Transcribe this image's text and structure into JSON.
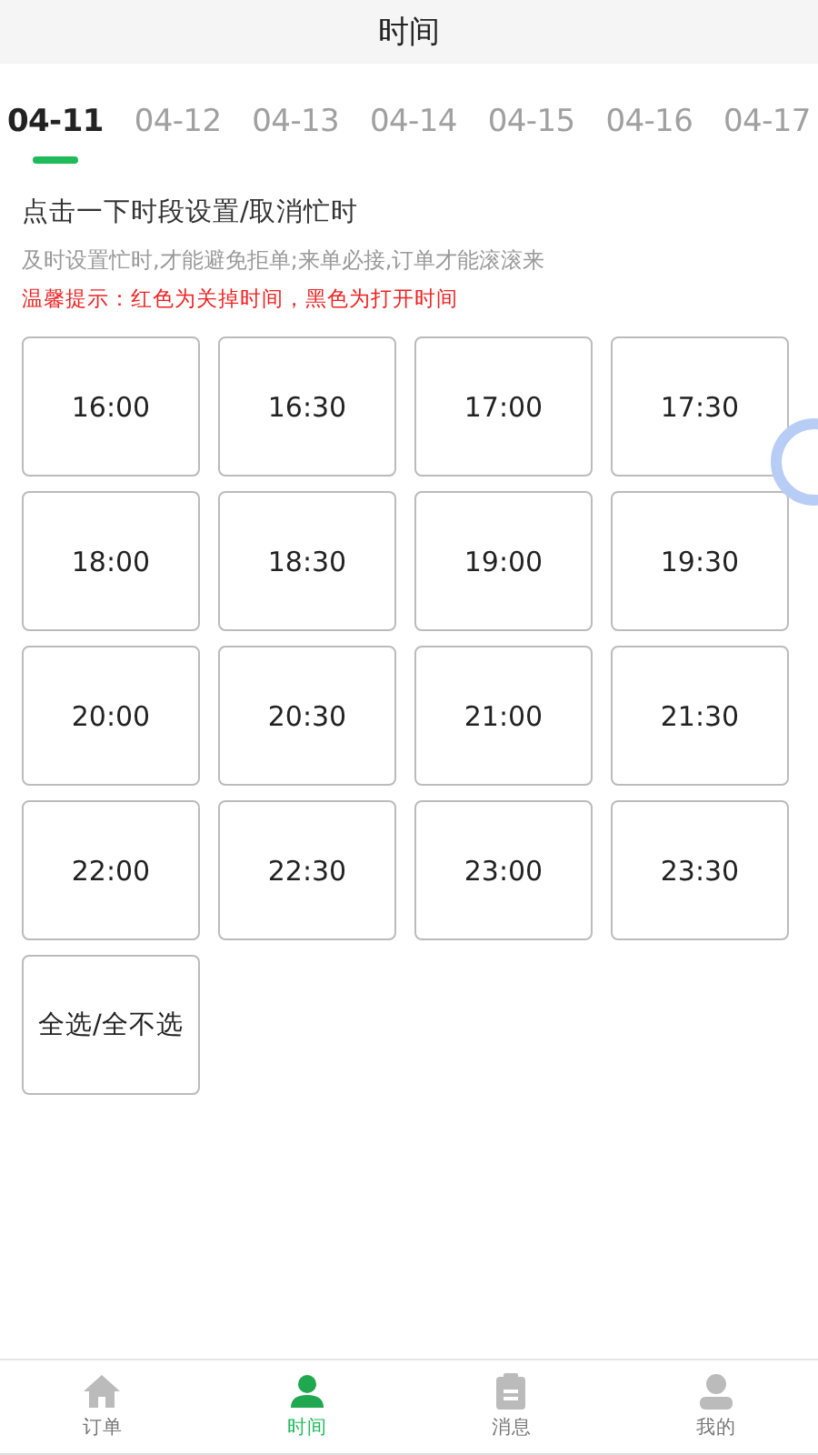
{
  "header": {
    "title": "时间"
  },
  "dates": [
    {
      "label": "04-11",
      "selected": true
    },
    {
      "label": "04-12",
      "selected": false
    },
    {
      "label": "04-13",
      "selected": false
    },
    {
      "label": "04-14",
      "selected": false
    },
    {
      "label": "04-15",
      "selected": false
    },
    {
      "label": "04-16",
      "selected": false
    },
    {
      "label": "04-17",
      "selected": false
    }
  ],
  "instruction": "点击一下时段设置/取消忙时",
  "hint": "及时设置忙时,才能避免拒单;来单必接,订单才能滚滚来",
  "tip": "温馨提示：红色为关掉时间，黑色为打开时间",
  "slots": [
    {
      "label": "16:00",
      "closed": false
    },
    {
      "label": "16:30",
      "closed": false
    },
    {
      "label": "17:00",
      "closed": false
    },
    {
      "label": "17:30",
      "closed": false
    },
    {
      "label": "18:00",
      "closed": false
    },
    {
      "label": "18:30",
      "closed": false
    },
    {
      "label": "19:00",
      "closed": false
    },
    {
      "label": "19:30",
      "closed": false
    },
    {
      "label": "20:00",
      "closed": false
    },
    {
      "label": "20:30",
      "closed": false
    },
    {
      "label": "21:00",
      "closed": false
    },
    {
      "label": "21:30",
      "closed": false
    },
    {
      "label": "22:00",
      "closed": false
    },
    {
      "label": "22:30",
      "closed": false
    },
    {
      "label": "23:00",
      "closed": false
    },
    {
      "label": "23:30",
      "closed": false
    }
  ],
  "select_all": "全选/全不选",
  "tabbar": [
    {
      "label": "订单",
      "kind": "home",
      "selected": false
    },
    {
      "label": "时间",
      "kind": "worker",
      "selected": true
    },
    {
      "label": "消息",
      "kind": "clipboard",
      "selected": false
    },
    {
      "label": "我的",
      "kind": "person",
      "selected": false
    }
  ]
}
